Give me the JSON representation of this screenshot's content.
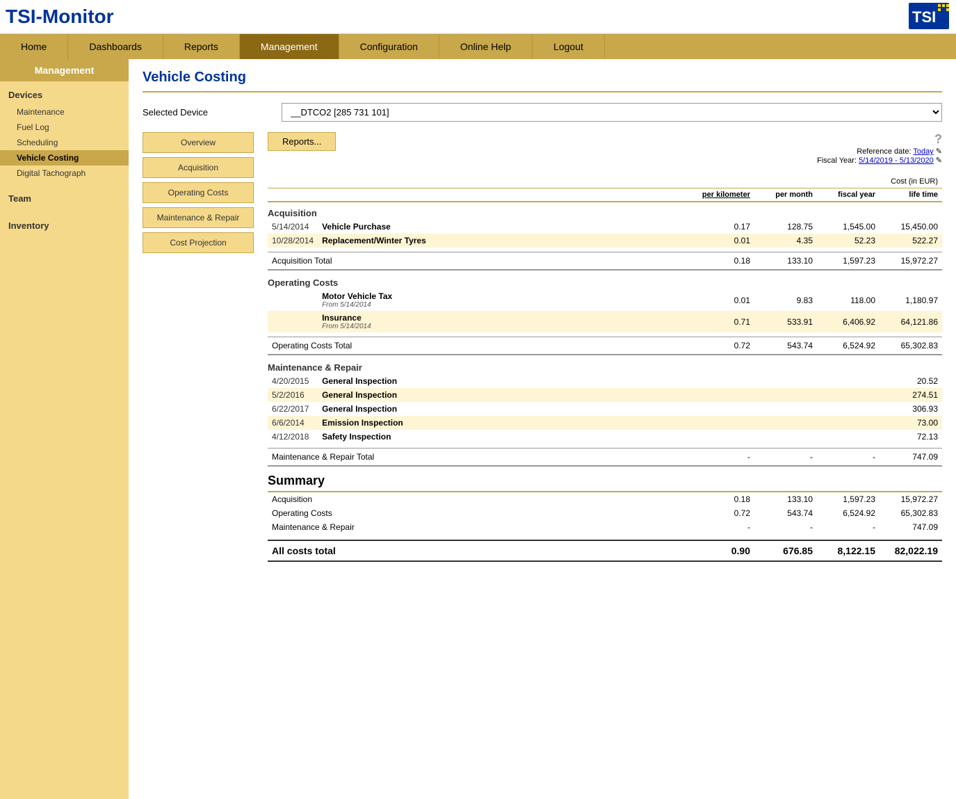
{
  "header": {
    "logo_main": "TSI-Monitor",
    "logo_tsi": "TSI"
  },
  "nav": {
    "items": [
      {
        "label": "Home",
        "active": false
      },
      {
        "label": "Dashboards",
        "active": false
      },
      {
        "label": "Reports",
        "active": false
      },
      {
        "label": "Management",
        "active": true
      },
      {
        "label": "Configuration",
        "active": false
      },
      {
        "label": "Online Help",
        "active": false
      },
      {
        "label": "Logout",
        "active": false
      }
    ]
  },
  "sidebar": {
    "title": "Management",
    "sections": [
      {
        "title": "Devices",
        "items": [
          {
            "label": "Maintenance",
            "active": false
          },
          {
            "label": "Fuel Log",
            "active": false
          },
          {
            "label": "Scheduling",
            "active": false
          },
          {
            "label": "Vehicle Costing",
            "active": true
          },
          {
            "label": "Digital Tachograph",
            "active": false
          }
        ]
      },
      {
        "title": "Team",
        "items": []
      },
      {
        "title": "Inventory",
        "items": []
      }
    ]
  },
  "page": {
    "title": "Vehicle Costing",
    "device_label": "Selected Device",
    "device_value": "__DTCO2 [285 731 101]"
  },
  "left_panel": {
    "buttons": [
      "Overview",
      "Acquisition",
      "Operating Costs",
      "Maintenance & Repair",
      "Cost Projection"
    ]
  },
  "controls": {
    "reports_btn": "Reports...",
    "reference_label": "Reference date:",
    "reference_value": "Today",
    "fiscal_label": "Fiscal Year:",
    "fiscal_value": "5/14/2019 - 5/13/2020",
    "help": "?"
  },
  "cost_header": {
    "cost_label": "Cost",
    "currency": "(in EUR)",
    "col1": "per kilometer",
    "col2": "per month",
    "col3": "fiscal year",
    "col4": "life time"
  },
  "acquisition": {
    "section_title": "Acquisition",
    "rows": [
      {
        "date": "5/14/2014",
        "name": "Vehicle Purchase",
        "col1": "0.17",
        "col2": "128.75",
        "col3": "1,545.00",
        "col4": "15,450.00",
        "shaded": false
      },
      {
        "date": "10/28/2014",
        "name": "Replacement/Winter Tyres",
        "col1": "0.01",
        "col2": "4.35",
        "col3": "52.23",
        "col4": "522.27",
        "shaded": true
      }
    ],
    "total_label": "Acquisition Total",
    "total": {
      "col1": "0.18",
      "col2": "133.10",
      "col3": "1,597.23",
      "col4": "15,972.27"
    }
  },
  "operating_costs": {
    "section_title": "Operating Costs",
    "rows": [
      {
        "name": "Motor Vehicle Tax",
        "subtitle": "From 5/14/2014",
        "col1": "0.01",
        "col2": "9.83",
        "col3": "118.00",
        "col4": "1,180.97",
        "shaded": false
      },
      {
        "name": "Insurance",
        "subtitle": "From 5/14/2014",
        "col1": "0.71",
        "col2": "533.91",
        "col3": "6,406.92",
        "col4": "64,121.86",
        "shaded": true
      }
    ],
    "total_label": "Operating Costs Total",
    "total": {
      "col1": "0.72",
      "col2": "543.74",
      "col3": "6,524.92",
      "col4": "65,302.83"
    }
  },
  "maintenance": {
    "section_title": "Maintenance & Repair",
    "rows": [
      {
        "date": "4/20/2015",
        "name": "General Inspection",
        "col4": "20.52",
        "shaded": false
      },
      {
        "date": "5/2/2016",
        "name": "General Inspection",
        "col4": "274.51",
        "shaded": true
      },
      {
        "date": "6/22/2017",
        "name": "General Inspection",
        "col4": "306.93",
        "shaded": false
      },
      {
        "date": "6/6/2014",
        "name": "Emission Inspection",
        "col4": "73.00",
        "shaded": true
      },
      {
        "date": "4/12/2018",
        "name": "Safety Inspection",
        "col4": "72.13",
        "shaded": false
      }
    ],
    "total_label": "Maintenance & Repair Total",
    "total": {
      "col1": "-",
      "col2": "-",
      "col3": "-",
      "col4": "747.09"
    }
  },
  "summary": {
    "title": "Summary",
    "rows": [
      {
        "label": "Acquisition",
        "col1": "0.18",
        "col2": "133.10",
        "col3": "1,597.23",
        "col4": "15,972.27"
      },
      {
        "label": "Operating Costs",
        "col1": "0.72",
        "col2": "543.74",
        "col3": "6,524.92",
        "col4": "65,302.83"
      },
      {
        "label": "Maintenance & Repair",
        "col1": "-",
        "col2": "-",
        "col3": "-",
        "col4": "747.09"
      }
    ],
    "all_total_label": "All costs total",
    "all_total": {
      "col1": "0.90",
      "col2": "676.85",
      "col3": "8,122.15",
      "col4": "82,022.19"
    }
  }
}
